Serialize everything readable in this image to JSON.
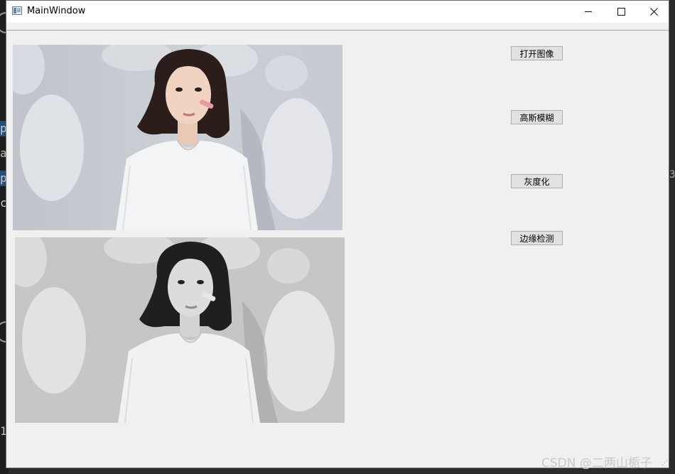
{
  "window": {
    "title": "MainWindow"
  },
  "title_controls": {
    "minimize": "minimize-icon",
    "maximize": "maximize-icon",
    "close": "close-icon"
  },
  "images": {
    "original": {
      "kind": "color-photo"
    },
    "processed": {
      "kind": "grayscale-photo"
    }
  },
  "buttons": {
    "open_image": "打开图像",
    "gaussian_blur": "高斯模糊",
    "grayscale": "灰度化",
    "edge_detection": "边缘检测"
  },
  "watermark": "CSDN @二两山栀子",
  "background_editor": {
    "glyphs": [
      "p",
      "a",
      "p",
      "c",
      "1"
    ],
    "right_glyph": "3"
  },
  "colors": {
    "window_bg": "#f0f0f0",
    "titlebar_bg": "#ffffff",
    "button_bg": "#e1e1e1",
    "button_border": "#adadad"
  }
}
